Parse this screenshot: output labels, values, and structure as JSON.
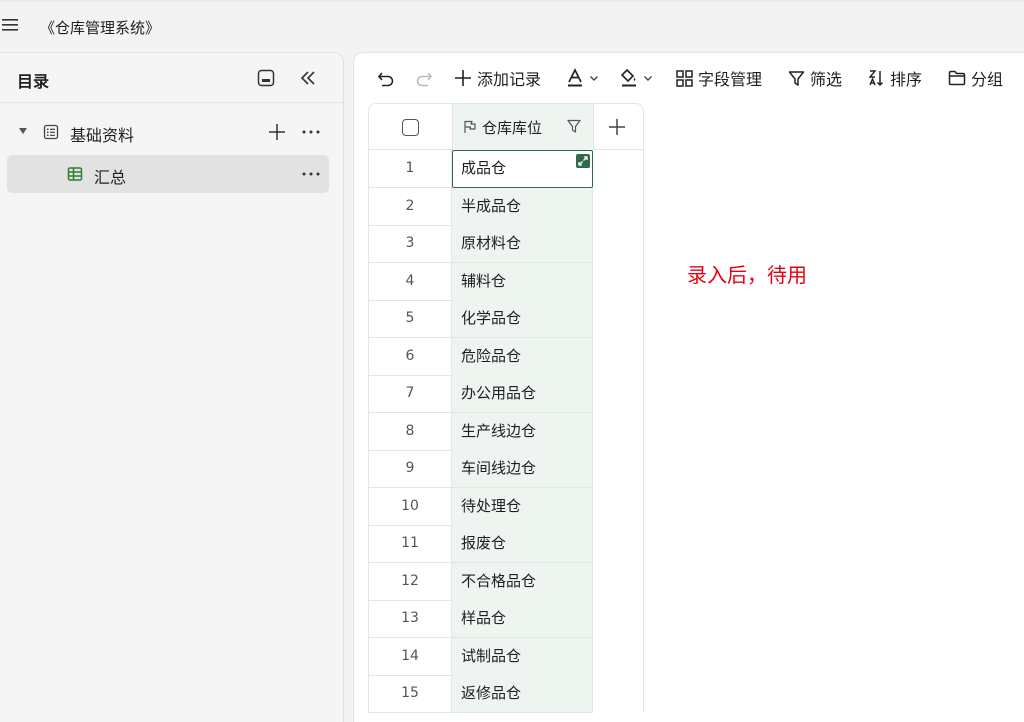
{
  "window": {
    "title": "《仓库管理系统》"
  },
  "sidebar": {
    "title": "目录",
    "folder": {
      "label": "基础资料"
    },
    "table": {
      "label": "汇总"
    }
  },
  "toolbar": {
    "add_record": "添加记录",
    "field_manage": "字段管理",
    "filter": "筛选",
    "sort": "排序",
    "group": "分组"
  },
  "grid": {
    "column_header": "仓库库位",
    "rows": [
      {
        "num": "1",
        "value": "成品仓"
      },
      {
        "num": "2",
        "value": "半成品仓"
      },
      {
        "num": "3",
        "value": "原材料仓"
      },
      {
        "num": "4",
        "value": "辅料仓"
      },
      {
        "num": "5",
        "value": "化学品仓"
      },
      {
        "num": "6",
        "value": "危险品仓"
      },
      {
        "num": "7",
        "value": "办公用品仓"
      },
      {
        "num": "8",
        "value": "生产线边仓"
      },
      {
        "num": "9",
        "value": "车间线边仓"
      },
      {
        "num": "10",
        "value": "待处理仓"
      },
      {
        "num": "11",
        "value": "报废仓"
      },
      {
        "num": "12",
        "value": "不合格品仓"
      },
      {
        "num": "13",
        "value": "样品仓"
      },
      {
        "num": "14",
        "value": "试制品仓"
      },
      {
        "num": "15",
        "value": "返修品仓"
      }
    ]
  },
  "annotation": {
    "text": "录入后，待用"
  },
  "colors": {
    "accent_green": "#2f6b4a",
    "note_red": "#e60012",
    "cell_bg": "#eef5f1"
  }
}
